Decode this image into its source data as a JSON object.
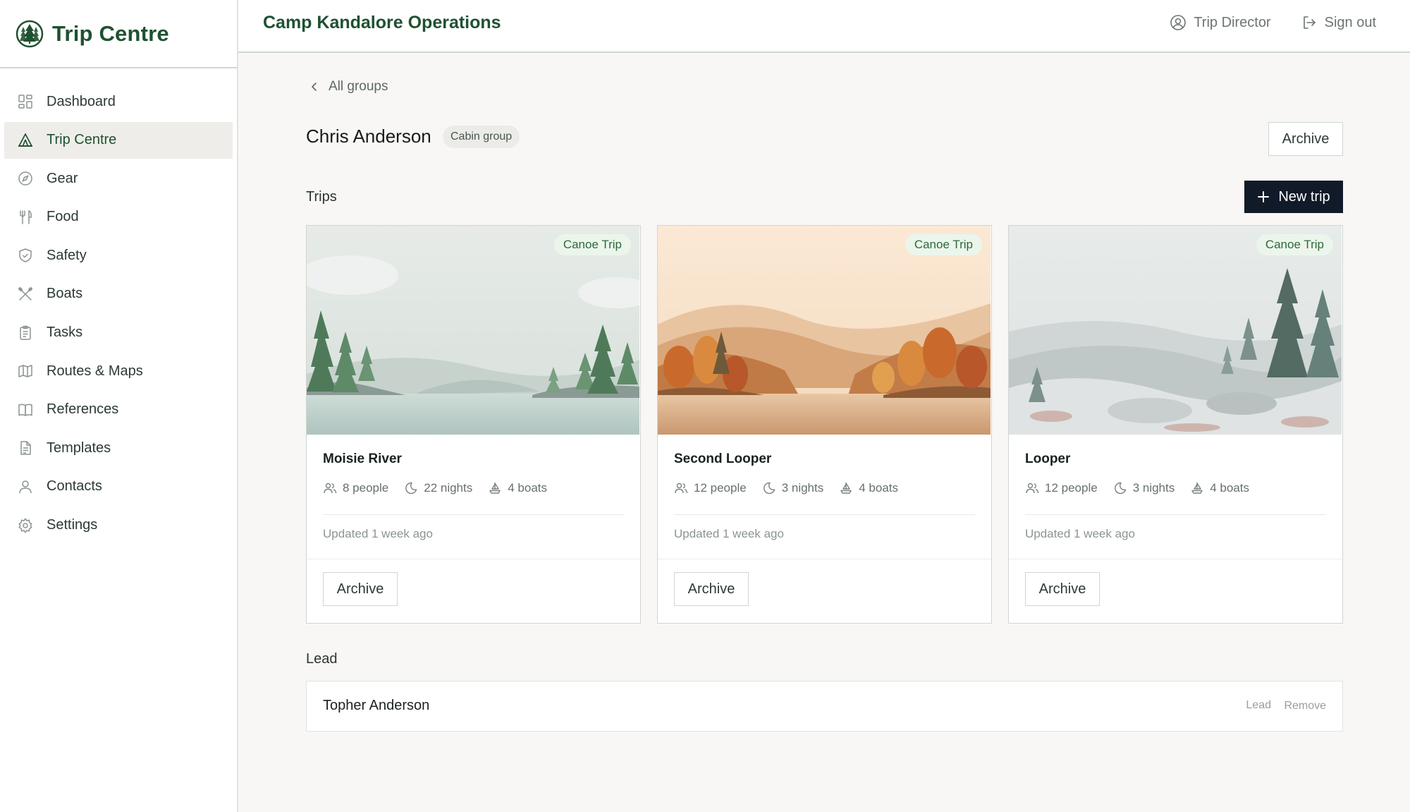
{
  "sidebar": {
    "brand": "Trip Centre",
    "items": [
      {
        "label": "Dashboard",
        "icon": "grid-icon"
      },
      {
        "label": "Trip Centre",
        "icon": "tent-icon",
        "active": true
      },
      {
        "label": "Gear",
        "icon": "compass-icon"
      },
      {
        "label": "Food",
        "icon": "utensils-icon"
      },
      {
        "label": "Safety",
        "icon": "shield-icon"
      },
      {
        "label": "Boats",
        "icon": "paddles-icon"
      },
      {
        "label": "Tasks",
        "icon": "clipboard-icon"
      },
      {
        "label": "Routes & Maps",
        "icon": "map-icon"
      },
      {
        "label": "References",
        "icon": "book-icon"
      },
      {
        "label": "Templates",
        "icon": "document-icon"
      },
      {
        "label": "Contacts",
        "icon": "user-icon"
      },
      {
        "label": "Settings",
        "icon": "gear-icon"
      }
    ]
  },
  "header": {
    "title": "Camp Kandalore Operations",
    "user_label": "Trip Director",
    "signout_label": "Sign out"
  },
  "main": {
    "breadcrumb": "All groups",
    "group_name": "Chris Anderson",
    "group_type": "Cabin group",
    "archive_label": "Archive",
    "trips_label": "Trips",
    "new_trip_label": "New trip",
    "trips": [
      {
        "tag": "Canoe Trip",
        "title": "Moisie River",
        "people": "8 people",
        "nights": "22 nights",
        "boats": "4 boats",
        "updated": "Updated 1 week ago",
        "archive": "Archive"
      },
      {
        "tag": "Canoe Trip",
        "title": "Second Looper",
        "people": "12 people",
        "nights": "3 nights",
        "boats": "4 boats",
        "updated": "Updated 1 week ago",
        "archive": "Archive"
      },
      {
        "tag": "Canoe Trip",
        "title": "Looper",
        "people": "12 people",
        "nights": "3 nights",
        "boats": "4 boats",
        "updated": "Updated 1 week ago",
        "archive": "Archive"
      }
    ],
    "lead_label": "Lead",
    "lead": {
      "name": "Topher Anderson",
      "role": "Lead",
      "remove": "Remove"
    }
  },
  "colors": {
    "brand_green": "#1f5130",
    "tag_bg": "#ecf5ec",
    "dark_button": "#111a28",
    "page_bg": "#f9f7f5"
  }
}
